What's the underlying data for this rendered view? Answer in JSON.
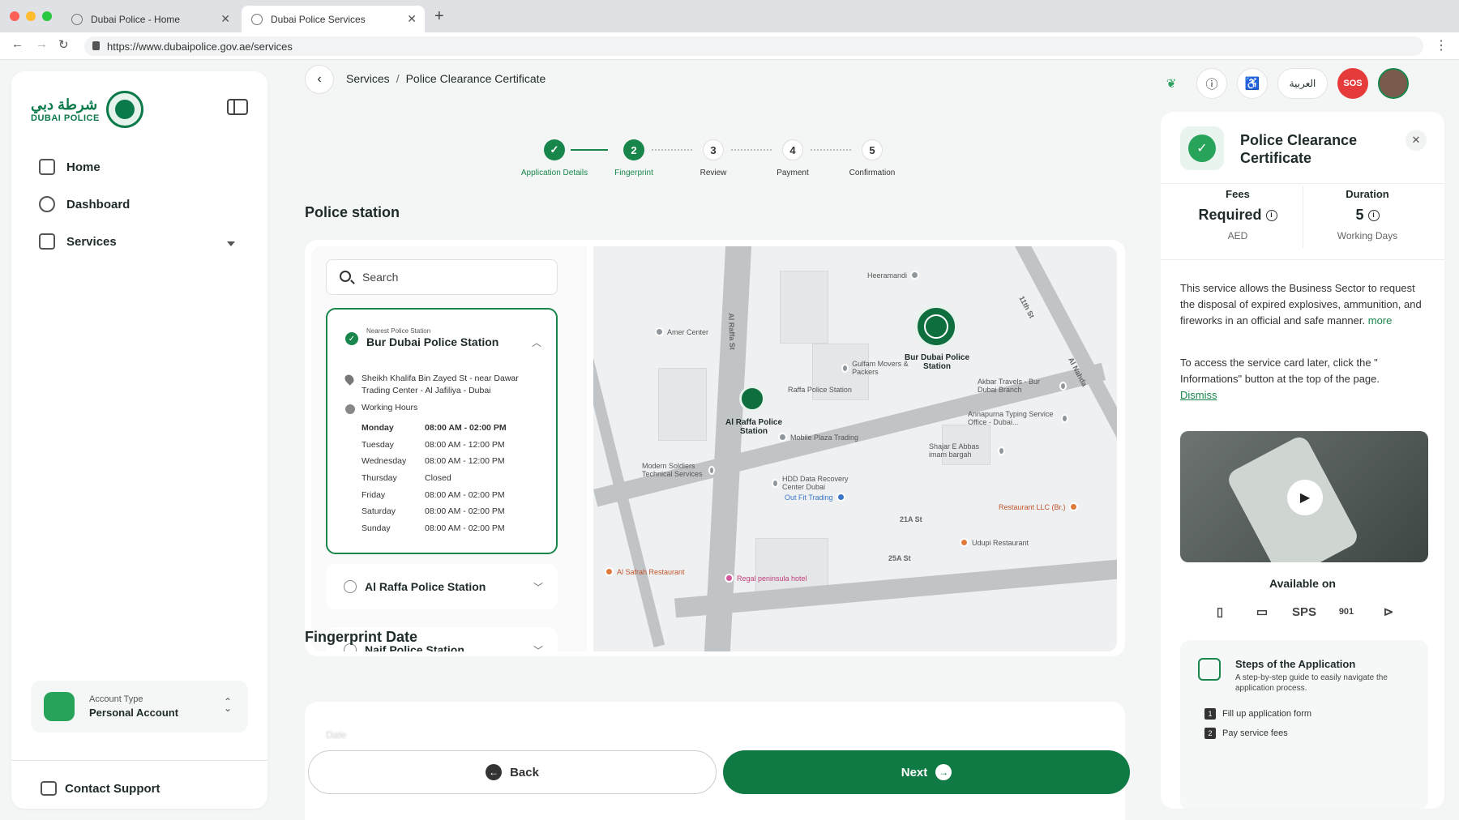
{
  "browser": {
    "tabs": [
      {
        "title": "Dubai Police - Home"
      },
      {
        "title": "Dubai Police Services"
      }
    ],
    "url": "https://www.dubaipolice.gov.ae/services"
  },
  "sidebar": {
    "logo_ar": "شرطة دبي",
    "logo_en": "DUBAI POLICE",
    "items": [
      {
        "label": "Home",
        "icon": "home-icon"
      },
      {
        "label": "Dashboard",
        "icon": "dashboard-icon"
      },
      {
        "label": "Services",
        "icon": "grid-icon"
      }
    ],
    "account": {
      "type_label": "Account Type",
      "name": "Personal Account"
    },
    "support_label": "Contact Support"
  },
  "header": {
    "breadcrumb": [
      "Services",
      "Police Clearance Certificate"
    ],
    "lang_label": "العربية",
    "sos_label": "SOS"
  },
  "stepper": [
    {
      "num": "",
      "label": "Application Details",
      "state": "done"
    },
    {
      "num": "2",
      "label": "Fingerprint",
      "state": "active"
    },
    {
      "num": "3",
      "label": "Review",
      "state": "todo"
    },
    {
      "num": "4",
      "label": "Payment",
      "state": "todo"
    },
    {
      "num": "5",
      "label": "Confirmation",
      "state": "todo"
    }
  ],
  "police_station": {
    "title": "Police station",
    "search_placeholder": "Search",
    "selected": {
      "tag": "Nearest Police Station",
      "name": "Bur Dubai Police Station",
      "address": "Sheikh Khalifa Bin Zayed St - near Dawar Trading Center - Al Jafiliya - Dubai",
      "hours_title": "Working Hours",
      "hours": [
        {
          "day": "Monday",
          "time": "08:00 AM - 02:00 PM"
        },
        {
          "day": "Tuesday",
          "time": "08:00 AM - 12:00 PM"
        },
        {
          "day": "Wednesday",
          "time": "08:00 AM - 12:00 PM"
        },
        {
          "day": "Thursday",
          "time": "Closed"
        },
        {
          "day": "Friday",
          "time": "08:00 AM - 02:00 PM"
        },
        {
          "day": "Saturday",
          "time": "08:00 AM - 02:00 PM"
        },
        {
          "day": "Sunday",
          "time": "08:00 AM - 02:00 PM"
        }
      ]
    },
    "others": [
      {
        "name": "Al Raffa Police Station"
      },
      {
        "name": "Naif Police Station"
      }
    ]
  },
  "map": {
    "roads": [
      "Al Raffa St",
      "21A St",
      "25A St",
      "11th St",
      "Al Nahda"
    ],
    "pois": [
      {
        "label": "Heeramandi"
      },
      {
        "label": "Amer Center"
      },
      {
        "label": "Gulfam Movers & Packers"
      },
      {
        "label": "Raffa Police Station"
      },
      {
        "label": "Mobile Plaza Trading"
      },
      {
        "label": "Akbar Travels - Bur Dubai Branch"
      },
      {
        "label": "Annapurna Typing Service Office - Dubai..."
      },
      {
        "label": "Shajar E Abbas imam bargah"
      },
      {
        "label": "Modern Soldiers Technical Services"
      },
      {
        "label": "HDD Data Recovery Center Dubai"
      },
      {
        "label": "Out Fit Trading"
      },
      {
        "label": "Restaurant LLC (Br.)"
      },
      {
        "label": "Udupi Restaurant"
      },
      {
        "label": "Al Safrah Restaurant"
      },
      {
        "label": "Regal peninsula hotel"
      }
    ],
    "pin_main": "Bur Dubai Police Station",
    "pin_secondary": "Al Raffa Police Station"
  },
  "fingerprint": {
    "title": "Fingerprint Date",
    "date_label": "Date"
  },
  "actions": {
    "back": "Back",
    "next": "Next"
  },
  "right_panel": {
    "title": "Police Clearance Certificate",
    "fees": {
      "label": "Fees",
      "value": "Required",
      "unit": "AED"
    },
    "duration": {
      "label": "Duration",
      "value": "5",
      "unit": "Working Days"
    },
    "description": "This service allows the Business Sector to request the disposal of expired explosives, ammunition, and fireworks in an official and safe manner.",
    "more": "more",
    "tip": "To access the service card later, click the \" Informations\" button at the top of the page.",
    "dismiss": "Dismiss",
    "available_on": "Available on",
    "channels": [
      "mobile-icon",
      "desktop-icon",
      "SPS",
      "901",
      "kiosk-icon"
    ],
    "steps": {
      "title": "Steps of the Application",
      "subtitle": "A step-by-step guide to easily navigate the application process.",
      "items": [
        "Fill up application form",
        "Pay service fees"
      ]
    }
  },
  "colors": {
    "brand": "#18864b",
    "sos": "#e53b3b"
  }
}
